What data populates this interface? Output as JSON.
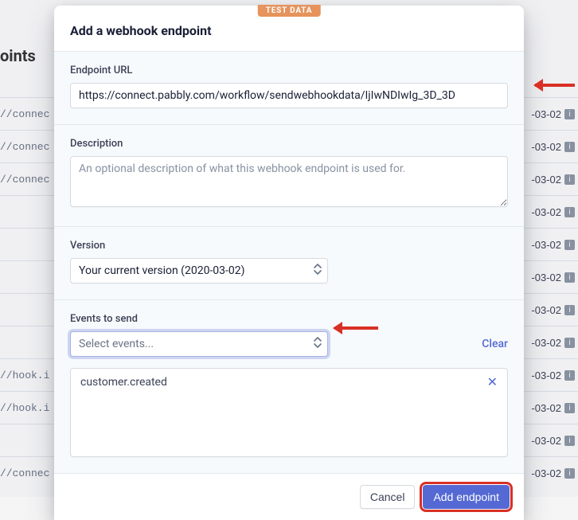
{
  "background": {
    "page_title": "oints",
    "rows": [
      {
        "url": "//connec",
        "date": "-03-02"
      },
      {
        "url": "//connec",
        "date": "-03-02"
      },
      {
        "url": "//connec",
        "date": "-03-02"
      },
      {
        "url": "",
        "date": "-03-02"
      },
      {
        "url": "",
        "date": "-03-02"
      },
      {
        "url": "",
        "date": "-03-02"
      },
      {
        "url": "",
        "date": "-03-02"
      },
      {
        "url": "",
        "date": "-03-02"
      },
      {
        "url": "//hook.i",
        "date": "-03-02"
      },
      {
        "url": "//hook.i",
        "date": "-03-02"
      },
      {
        "url": "",
        "date": "-03-02"
      },
      {
        "url": "//connec",
        "date": "-03-02"
      }
    ]
  },
  "modal": {
    "badge": "TEST DATA",
    "title": "Add a webhook endpoint",
    "endpoint": {
      "label": "Endpoint URL",
      "value": "https://connect.pabbly.com/workflow/sendwebhookdata/IjIwNDIwIg_3D_3D"
    },
    "description": {
      "label": "Description",
      "placeholder": "An optional description of what this webhook endpoint is used for."
    },
    "version": {
      "label": "Version",
      "selected": "Your current version (2020-03-02)"
    },
    "events": {
      "label": "Events to send",
      "select_placeholder": "Select events...",
      "clear": "Clear",
      "items": [
        "customer.created"
      ]
    },
    "footer": {
      "cancel": "Cancel",
      "submit": "Add endpoint"
    }
  }
}
